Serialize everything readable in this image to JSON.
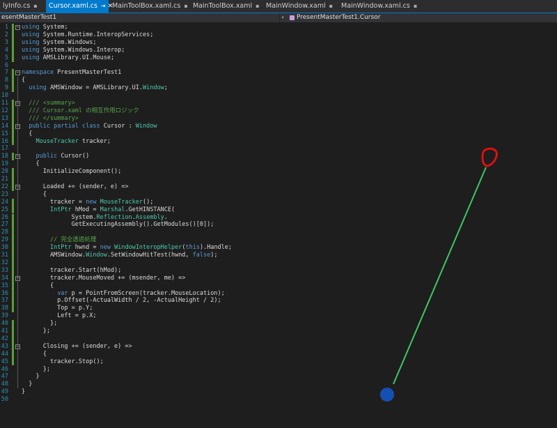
{
  "tabs": [
    {
      "label": "lyInfo.cs",
      "pinned": true,
      "active": false
    },
    {
      "label": "Cursor.xaml.cs",
      "pinned": true,
      "active": true
    },
    {
      "label": "MainToolBox.xaml.cs",
      "pinned": true,
      "active": false
    },
    {
      "label": "MainToolBox.xaml",
      "pinned": true,
      "active": false
    },
    {
      "label": "MainWindow.xaml",
      "pinned": true,
      "active": false
    },
    {
      "label": "MainWindow.xaml.cs",
      "pinned": true,
      "active": false
    }
  ],
  "nav": {
    "project": "esentMasterTest1",
    "member": "PresentMasterTest1.Cursor"
  },
  "editor": {
    "line_numbers": [
      "1",
      "2",
      "3",
      "4",
      "5",
      "6",
      "7",
      "8",
      "9",
      "10",
      "11",
      "12",
      "13",
      "14",
      "15",
      "16",
      "17",
      "18",
      "19",
      "20",
      "21",
      "22",
      "23",
      "24",
      "25",
      "26",
      "27",
      "28",
      "29",
      "30",
      "31",
      "32",
      "33",
      "34",
      "35",
      "36",
      "37",
      "38",
      "39",
      "40",
      "41",
      "42",
      "43",
      "44",
      "45",
      "46",
      "47",
      "48",
      "49",
      "50"
    ],
    "lines": [
      "using System;",
      "using System.Runtime.InteropServices;",
      "using System.Windows;",
      "using System.Windows.Interop;",
      "using AMSLibrary.UI.Mouse;",
      "",
      "namespace PresentMasterTest1",
      "{",
      "  using AMSWindow = AMSLibrary.UI.Window;",
      "",
      "  /// <summary>",
      "  /// Cursor.xaml の相互作用ロジック",
      "  /// </summary>",
      "  public partial class Cursor : Window",
      "  {",
      "    MouseTracker tracker;",
      "",
      "    public Cursor()",
      "    {",
      "      InitializeComponent();",
      "",
      "      Loaded += (sender, e) =>",
      "      {",
      "        tracker = new MouseTracker();",
      "        IntPtr hMod = Marshal.GetHINSTANCE(",
      "              System.Reflection.Assembly.",
      "              GetExecutingAssembly().GetModules()[0]);",
      "",
      "        // 完全透過処理",
      "        IntPtr hwnd = new WindowInteropHelper(this).Handle;",
      "        AMSWindow.Window.SetWindowHitTest(hwnd, false);",
      "",
      "        tracker.Start(hMod);",
      "        tracker.MouseMoved += (msender, me) =>",
      "        {",
      "          var p = PointFromScreen(tracker.MouseLocation);",
      "          p.Offset(-ActualWidth / 2, -ActualHeight / 2);",
      "          Top = p.Y;",
      "          Left = p.X;",
      "        };",
      "      };",
      "",
      "      Closing += (sender, e) =>",
      "      {",
      "        tracker.Stop();",
      "      };",
      "    }",
      "  }",
      "}",
      ""
    ]
  },
  "colors": {
    "accent": "#007acc",
    "line_color": "#3cc864",
    "circle_red": "#e01010",
    "dot_blue": "#1450b4"
  }
}
